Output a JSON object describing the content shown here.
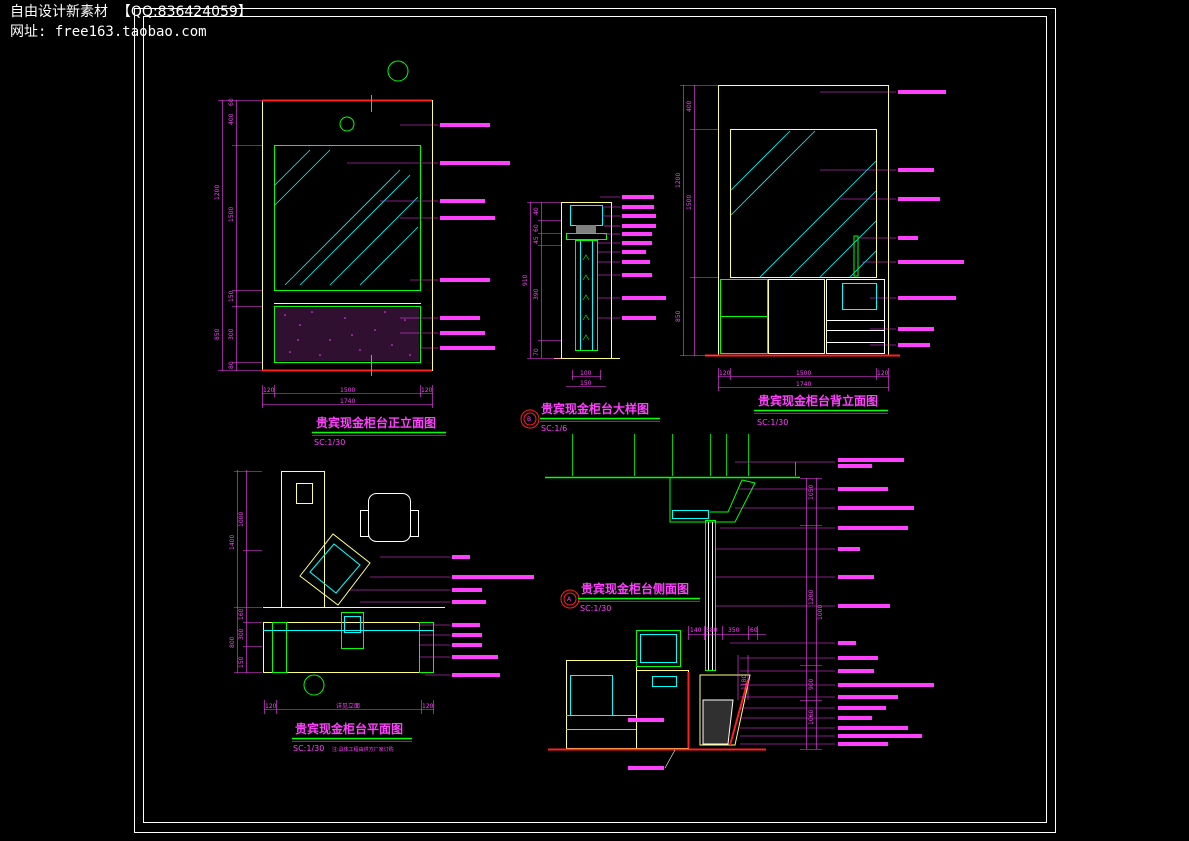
{
  "watermark": {
    "line1": "自由设计新素材  【QQ:836424059】",
    "line2": "网址: free163.taobao.com"
  },
  "colors": {
    "background": "#000000",
    "frame": "#ffffff",
    "outline": "#ffff80",
    "glass": "#00ffff",
    "green": "#00ff00",
    "magenta": "#ff40ff",
    "floor": "#ff2020",
    "white": "#ffffff"
  },
  "views": {
    "front": {
      "title": "贵宾现金柜台正立面图",
      "scale": "SC:1/30"
    },
    "detail": {
      "title": "贵宾现金柜台大样图",
      "scale": "SC:1/6",
      "marker": "B"
    },
    "back": {
      "title": "贵宾现金柜台背立面图",
      "scale": "SC:1/30"
    },
    "plan": {
      "title": "贵宾现金柜台平面图",
      "scale": "SC:1/30",
      "note": "注:具体工程由供方厂家订购"
    },
    "section": {
      "title": "贵宾现金柜台侧面图",
      "scale": "SC:1/30",
      "marker": "A"
    }
  },
  "dimensions": {
    "front_vertical": [
      "60",
      "400",
      "1500",
      "1200",
      "150",
      "850",
      "300",
      "80"
    ],
    "front_horizontal": [
      "120",
      "1500",
      "120",
      "1740"
    ],
    "detail_vertical": [
      "40",
      "60",
      "45",
      "910",
      "390",
      "70"
    ],
    "detail_horizontal": [
      "100",
      "150"
    ],
    "back_vertical": [
      "400",
      "1500",
      "1200",
      "850"
    ],
    "back_horizontal": [
      "120",
      "1500",
      "120",
      "1740"
    ],
    "plan_vertical": [
      "1400",
      "1000",
      "160",
      "800",
      "300",
      "150"
    ],
    "plan_horizontal": [
      "120",
      "详见立面",
      "120"
    ],
    "section_horizontal": [
      "140",
      "580",
      "350",
      "60",
      "1180"
    ],
    "section_vertical": [
      "1050",
      "1200",
      "1000",
      "900",
      "1060"
    ]
  }
}
